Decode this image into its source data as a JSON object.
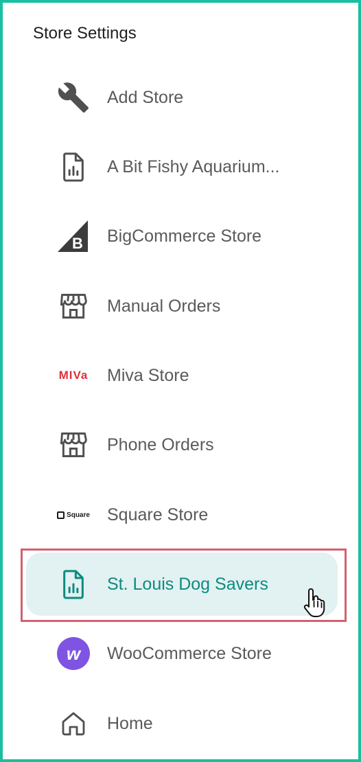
{
  "section": {
    "title": "Store Settings"
  },
  "menu": {
    "items": [
      {
        "label": "Add Store",
        "icon": "wrench-icon"
      },
      {
        "label": "A Bit Fishy Aquarium...",
        "icon": "report-file-icon"
      },
      {
        "label": "BigCommerce Store",
        "icon": "bigcommerce-logo-icon"
      },
      {
        "label": "Manual Orders",
        "icon": "storefront-icon"
      },
      {
        "label": "Miva Store",
        "icon": "miva-logo-icon",
        "logo_text": "MIVa"
      },
      {
        "label": "Phone Orders",
        "icon": "storefront-icon"
      },
      {
        "label": "Square Store",
        "icon": "square-logo-icon",
        "logo_text": "Square"
      },
      {
        "label": "St. Louis Dog Savers",
        "icon": "report-file-icon",
        "active": true
      },
      {
        "label": "WooCommerce Store",
        "icon": "woocommerce-logo-icon",
        "logo_text": "w"
      },
      {
        "label": "Home",
        "icon": "home-icon"
      }
    ]
  },
  "colors": {
    "frame_border": "#19bfa0",
    "active_bg": "#e2f1f1",
    "active_text": "#0e8a80",
    "highlight_border": "#d2616f",
    "label_text": "#5a5a5a",
    "miva_red": "#e0303c",
    "woo_purple": "#7f54e3"
  }
}
